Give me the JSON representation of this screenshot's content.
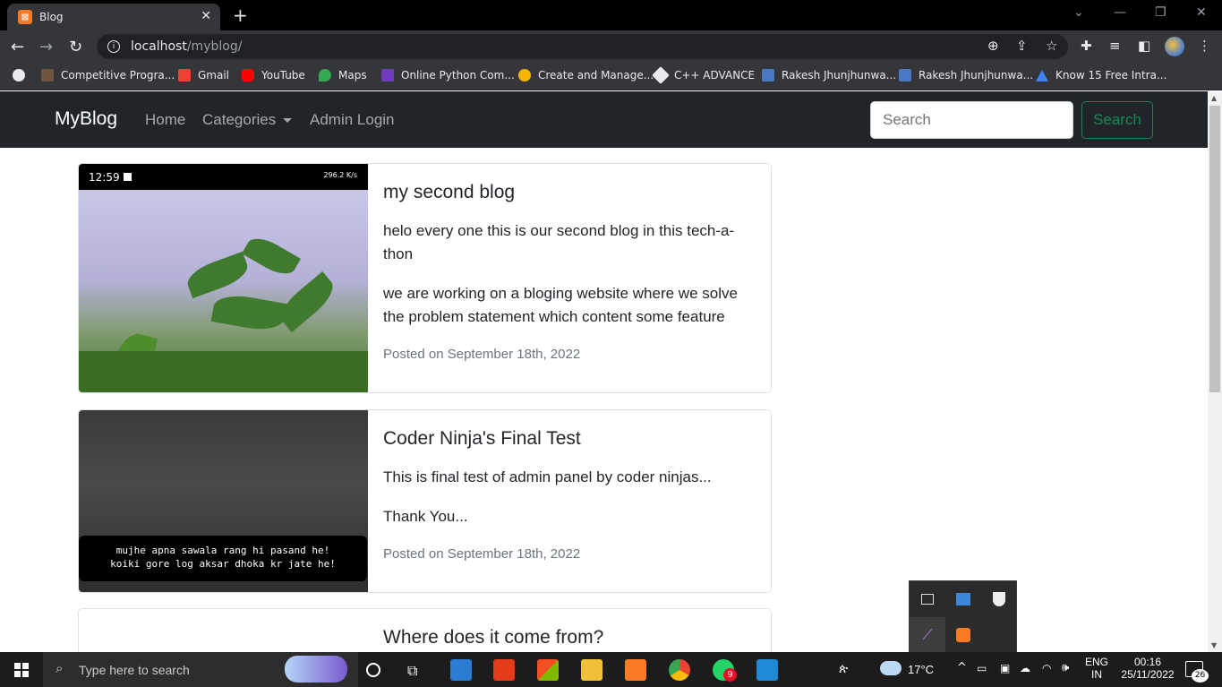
{
  "browser": {
    "tab_title": "Blog",
    "tab_favicon": "XAMPP",
    "new_tab": "+",
    "url_host": "localhost",
    "url_path": "/myblog/",
    "bookmarks": [
      {
        "label": "Competitive Progra...",
        "icon": "cc-icon"
      },
      {
        "label": "Gmail",
        "icon": "gmail-icon"
      },
      {
        "label": "YouTube",
        "icon": "youtube-icon"
      },
      {
        "label": "Maps",
        "icon": "maps-icon"
      },
      {
        "label": "Online Python Com...",
        "icon": "python-icon"
      },
      {
        "label": "Create and Manage...",
        "icon": "manage-icon"
      },
      {
        "label": "C++ ADVANCE",
        "icon": "cpp-icon"
      },
      {
        "label": "Rakesh Jhunjhunwa...",
        "icon": "article-icon"
      },
      {
        "label": "Rakesh Jhunjhunwa...",
        "icon": "article-icon"
      },
      {
        "label": "Know 15 Free Intra...",
        "icon": "triangle-icon"
      }
    ]
  },
  "site": {
    "brand": "MyBlog",
    "nav": {
      "home": "Home",
      "categories": "Categories",
      "admin": "Admin Login"
    },
    "search": {
      "placeholder": "Search",
      "button": "Search"
    }
  },
  "posts": [
    {
      "title": "my second blog",
      "paragraphs": [
        " helo every one this is our second blog in this tech-a-thon",
        "we are working on a  bloging website where we solve the problem statement which content  some feature"
      ],
      "date": "Posted on September 18th, 2022",
      "phone_time": "12:59",
      "phone_status": "296.2 K/s"
    },
    {
      "title": "Coder Ninja's Final Test",
      "paragraphs": [
        "This is final test of admin panel by coder ninjas...",
        "Thank You..."
      ],
      "date": "Posted on September 18th, 2022",
      "caption_line1": "mujhe apna sawala rang hi pasand he!",
      "caption_line2": "koiki gore log aksar dhoka kr jate he!"
    },
    {
      "title": "Where does it come from?"
    }
  ],
  "taskbar": {
    "search_placeholder": "Type here to search",
    "temperature": "17°C",
    "lang1": "ENG",
    "lang2": "IN",
    "time": "00:16",
    "date": "25/11/2022",
    "notifications": "26",
    "whatsapp_badge": "9"
  }
}
